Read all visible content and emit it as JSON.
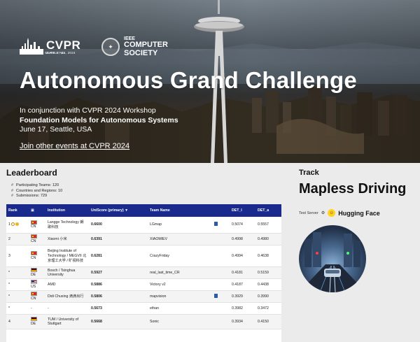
{
  "hero": {
    "cvpr_brand": "CVPR",
    "cvpr_location": "SEATTLE, WA",
    "cvpr_dates": "JUNE 17-21, 2024",
    "ieee_line1": "IEEE",
    "ieee_line2": "COMPUTER",
    "ieee_line3": "SOCIETY",
    "title": "Autonomous Grand Challenge",
    "subtitle_line1": "In conjunction with CVPR 2024 Workshop",
    "subtitle_line2": "Foundation Models for Autonomous Systems",
    "subtitle_line3": "June 17, Seattle, USA",
    "link": "Join other events at CVPR 2024"
  },
  "leaderboard": {
    "title": "Leaderboard",
    "stats": [
      "Participating Teams: 120",
      "Countries and Regions: 10",
      "Submissions: 729"
    ],
    "columns": [
      "Rank",
      "",
      "Institution",
      "UniScore (primary)",
      "Team Name",
      "",
      "DET_l",
      "DET_a"
    ],
    "rows": [
      {
        "rank": "1",
        "country": "CN",
        "flag": "cn",
        "institution": "Langge Technology 朗歌科技",
        "score": "0.6600",
        "team": "LGmap",
        "doc": true,
        "det_l": "0.5074",
        "det_a": "0.5557",
        "medal": true
      },
      {
        "rank": "2",
        "country": "CN",
        "flag": "cn",
        "institution": "Xiaomi 小米",
        "score": "0.6391",
        "team": "XIAOMIEV",
        "doc": false,
        "det_l": "0.4998",
        "det_a": "0.4980",
        "medal": false
      },
      {
        "rank": "3",
        "country": "CN",
        "flag": "cn",
        "institution": "Beijing Institute of Technology / MEGVII 北京理工大学 / 旷视科技",
        "score": "0.6281",
        "team": "CrazyFriday",
        "doc": false,
        "det_l": "0.4994",
        "det_a": "0.4638",
        "medal": false
      },
      {
        "rank": "*",
        "country": "DE",
        "flag": "de",
        "institution": "Bosch / Tsinghua University",
        "score": "0.5927",
        "team": "real_last_time_CR",
        "doc": false,
        "det_l": "0.4181",
        "det_a": "0.5159",
        "medal": false
      },
      {
        "rank": "*",
        "country": "US",
        "flag": "us",
        "institution": "AMD",
        "score": "0.5886",
        "team": "Victory v2",
        "doc": false,
        "det_l": "0.4187",
        "det_a": "0.4438",
        "medal": false
      },
      {
        "rank": "*",
        "country": "CN",
        "flag": "cn",
        "institution": "Didi Chuxing 滴滴出行",
        "score": "0.5806",
        "team": "mapvision",
        "doc": true,
        "det_l": "0.3929",
        "det_a": "0.3990",
        "medal": false
      },
      {
        "rank": "*",
        "country": "-",
        "flag": "",
        "institution": "-",
        "score": "0.5673",
        "team": "ethan",
        "doc": false,
        "det_l": "0.3982",
        "det_a": "0.3472",
        "medal": false
      },
      {
        "rank": "4",
        "country": "DE",
        "flag": "de",
        "institution": "TUM / University of Stuttgart",
        "score": "0.5668",
        "team": "Sonic",
        "doc": false,
        "det_l": "0.3934",
        "det_a": "0.4150",
        "medal": false
      }
    ]
  },
  "track": {
    "label": "Track",
    "title": "Mapless Driving",
    "test_server_label": "Test Server",
    "provider": "Hugging Face"
  }
}
